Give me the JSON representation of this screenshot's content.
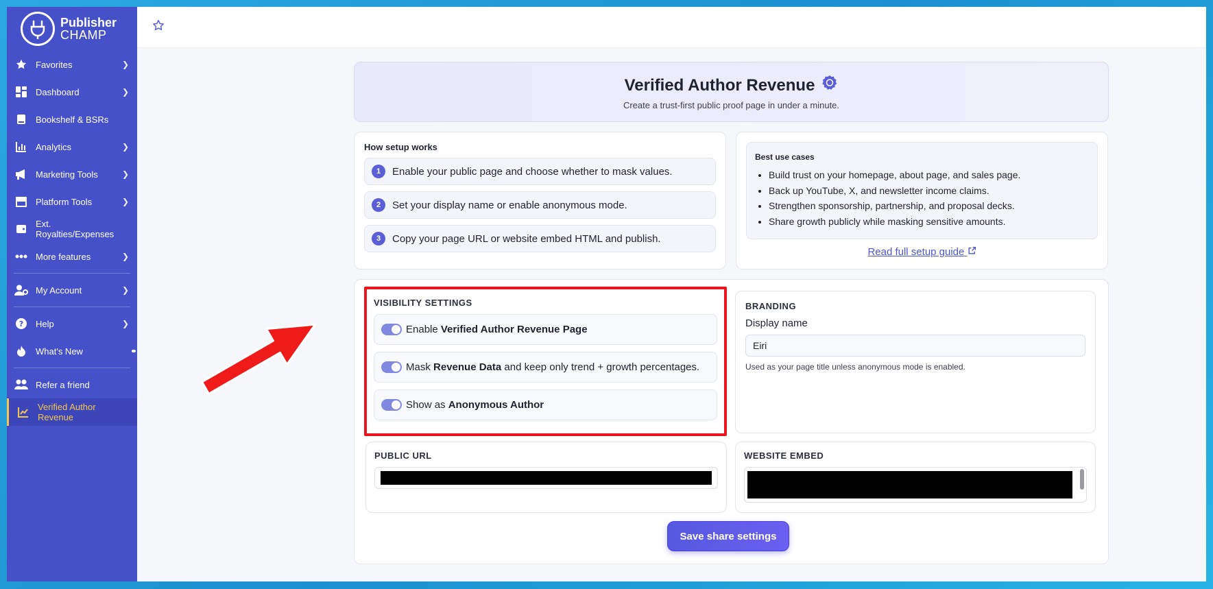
{
  "brand": {
    "line1": "Publisher",
    "line2": "CHAMP"
  },
  "sidebar": {
    "items": [
      {
        "label": "Favorites",
        "icon": "star-icon",
        "chevron": true
      },
      {
        "label": "Dashboard",
        "icon": "dashboard-icon",
        "chevron": true
      },
      {
        "label": "Bookshelf & BSRs",
        "icon": "book-icon",
        "chevron": false
      },
      {
        "label": "Analytics",
        "icon": "chart-bar-icon",
        "chevron": true
      },
      {
        "label": "Marketing Tools",
        "icon": "megaphone-icon",
        "chevron": true
      },
      {
        "label": "Platform Tools",
        "icon": "store-icon",
        "chevron": true
      },
      {
        "label": "Ext. Royalties/Expenses",
        "icon": "wallet-icon",
        "chevron": false
      },
      {
        "label": "More features",
        "icon": "ellipsis-icon",
        "chevron": true
      },
      {
        "label": "My Account",
        "icon": "user-gear-icon",
        "chevron": true
      },
      {
        "label": "Help",
        "icon": "question-icon",
        "chevron": true
      },
      {
        "label": "What's New",
        "icon": "flame-icon",
        "chevron": false
      },
      {
        "label": "Refer a friend",
        "icon": "users-icon",
        "chevron": false
      },
      {
        "label": "Verified Author Revenue",
        "icon": "chart-line-icon",
        "chevron": false,
        "active": true
      }
    ]
  },
  "hero": {
    "title": "Verified Author Revenue",
    "subtitle": "Create a trust-first public proof page in under a minute."
  },
  "how": {
    "title": "How setup works",
    "steps": [
      {
        "num": "1",
        "text": "Enable your public page and choose whether to mask values."
      },
      {
        "num": "2",
        "text": "Set your display name or enable anonymous mode."
      },
      {
        "num": "3",
        "text": "Copy your page URL or website embed HTML and publish."
      }
    ]
  },
  "best": {
    "title": "Best use cases",
    "items": [
      "Build trust on your homepage, about page, and sales page.",
      "Back up YouTube, X, and newsletter income claims.",
      "Strengthen sponsorship, partnership, and proposal decks.",
      "Share growth publicly while masking sensitive amounts."
    ],
    "guide_link": "Read full setup guide"
  },
  "visibility": {
    "title": "VISIBILITY SETTINGS",
    "toggles": [
      {
        "pre": "Enable ",
        "bold": "Verified Author Revenue Page",
        "post": "",
        "on": true
      },
      {
        "pre": "Mask ",
        "bold": "Revenue Data",
        "post": " and keep only trend + growth percentages.",
        "on": true
      },
      {
        "pre": "Show as ",
        "bold": "Anonymous Author",
        "post": "",
        "on": true
      }
    ]
  },
  "branding": {
    "title": "BRANDING",
    "display_label": "Display name",
    "display_value": "Eiri",
    "hint": "Used as your page title unless anonymous mode is enabled."
  },
  "public_url": {
    "title": "PUBLIC URL"
  },
  "website_embed": {
    "title": "WEBSITE EMBED"
  },
  "save_label": "Save share settings",
  "colors": {
    "sidebar": "#4650c8",
    "accent": "#5a5fd6",
    "highlight": "#e8141e",
    "active_text": "#f3c64e"
  }
}
